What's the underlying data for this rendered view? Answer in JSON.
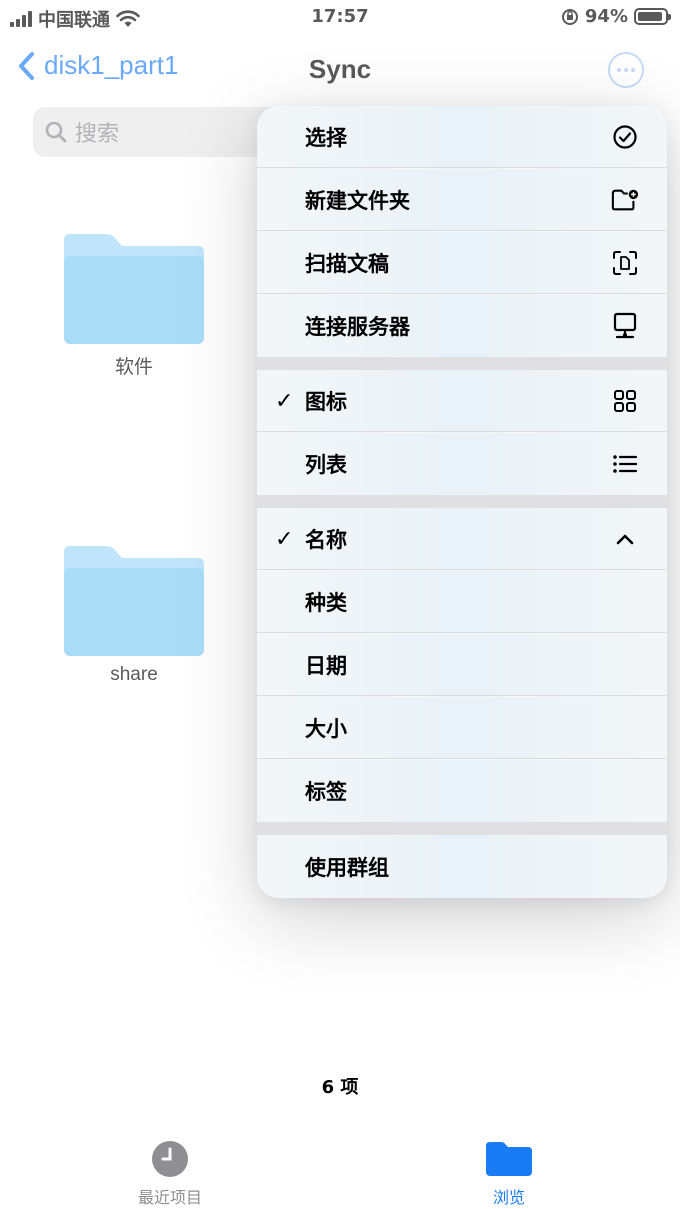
{
  "status_bar": {
    "carrier": "中国联通",
    "time": "17:57",
    "battery_percent": "94%",
    "battery_level": 0.94
  },
  "nav": {
    "back_label": "disk1_part1",
    "title": "Sync"
  },
  "search": {
    "placeholder": "搜索"
  },
  "folders": [
    {
      "name": "软件"
    },
    {
      "name": "share"
    }
  ],
  "menu": {
    "actions": [
      {
        "label": "选择",
        "icon": "checkmark-circle-icon"
      },
      {
        "label": "新建文件夹",
        "icon": "new-folder-icon"
      },
      {
        "label": "扫描文稿",
        "icon": "scan-document-icon"
      },
      {
        "label": "连接服务器",
        "icon": "monitor-icon"
      }
    ],
    "views": [
      {
        "label": "图标",
        "checked": true,
        "icon": "grid-icon"
      },
      {
        "label": "列表",
        "checked": false,
        "icon": "list-icon"
      }
    ],
    "sort": [
      {
        "label": "名称",
        "checked": true,
        "icon": "chevron-up-icon"
      },
      {
        "label": "种类",
        "checked": false
      },
      {
        "label": "日期",
        "checked": false
      },
      {
        "label": "大小",
        "checked": false
      },
      {
        "label": "标签",
        "checked": false
      }
    ],
    "group": {
      "label": "使用群组"
    },
    "check_mark": "✓"
  },
  "footer": {
    "count": "6 项"
  },
  "tabbar": {
    "recents": "最近项目",
    "browse": "浏览"
  },
  "colors": {
    "accent": "#1a7cf5",
    "folder_top": "#9fd8f8",
    "folder_body": "#7ccbf3"
  }
}
